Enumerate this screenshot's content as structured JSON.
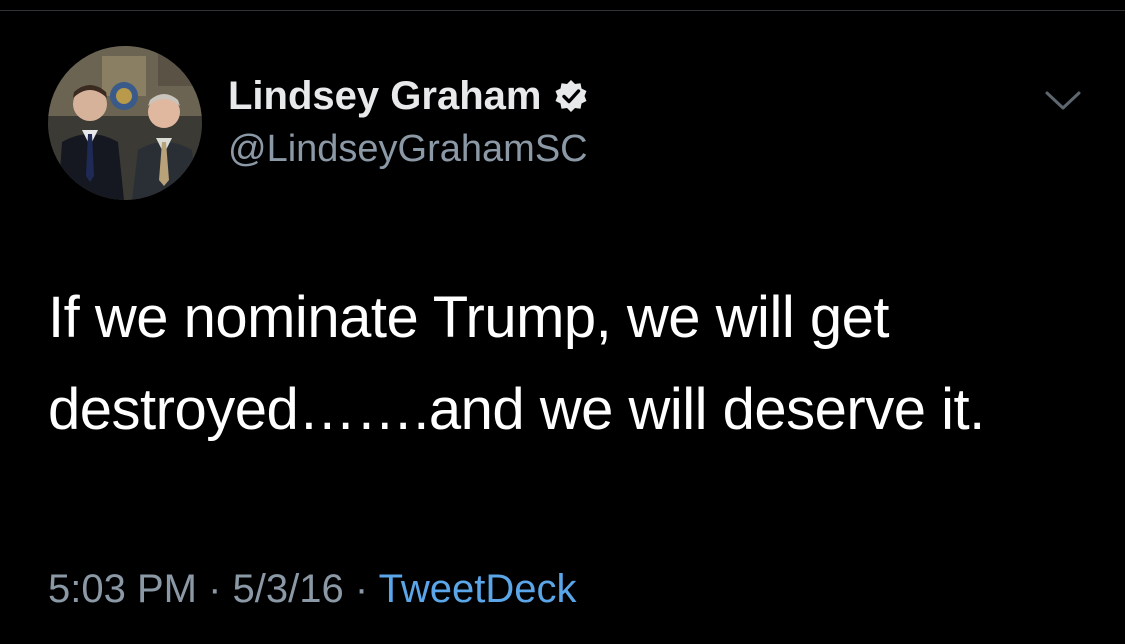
{
  "tweet": {
    "author": {
      "display_name": "Lindsey Graham",
      "handle": "@LindseyGrahamSC",
      "verified": true,
      "avatar_icon": "avatar-photo"
    },
    "text_line1": "If we nominate Trump, we will get",
    "text_line2": "destroyed…….and we will deserve it.",
    "time": "5:03 PM",
    "separator": "·",
    "date": "5/3/16",
    "source": "TweetDeck",
    "menu_icon": "chevron-down-icon"
  },
  "colors": {
    "background": "#000000",
    "primary_text": "#ffffff",
    "secondary_text": "#8b98a5",
    "link": "#5aa6e8"
  }
}
